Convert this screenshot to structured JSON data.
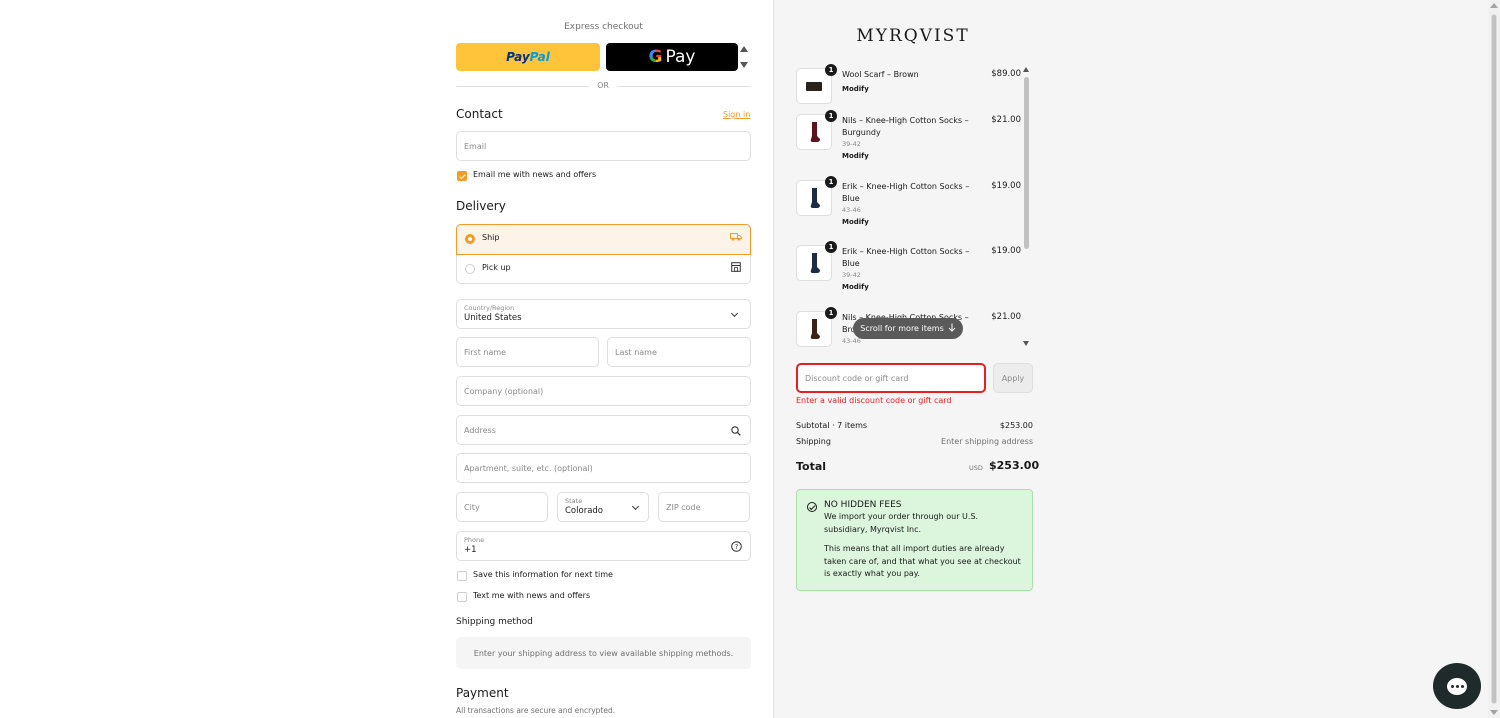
{
  "express": {
    "label": "Express checkout",
    "paypal_pay": "Pay",
    "paypal_pal": "Pal",
    "gpay_g": "G",
    "gpay_label": "Pay",
    "or_label": "OR"
  },
  "contact": {
    "heading": "Contact",
    "sign_in": "Sign in",
    "email_placeholder": "Email",
    "news_checkbox": "Email me with news and offers",
    "news_checked": true
  },
  "delivery": {
    "heading": "Delivery",
    "ship_label": "Ship",
    "pickup_label": "Pick up",
    "selected": "Ship",
    "country_label": "Country/Region",
    "country_value": "United States",
    "first_name_placeholder": "First name",
    "last_name_placeholder": "Last name",
    "company_placeholder": "Company (optional)",
    "address_placeholder": "Address",
    "apartment_placeholder": "Apartment, suite, etc. (optional)",
    "city_placeholder": "City",
    "state_label": "State",
    "state_value": "Colorado",
    "zip_placeholder": "ZIP code",
    "phone_label": "Phone",
    "phone_value": "+1",
    "save_info": "Save this information for next time",
    "text_me": "Text me with news and offers"
  },
  "shipping_method": {
    "heading": "Shipping method",
    "message": "Enter your shipping address to view available shipping methods."
  },
  "payment": {
    "heading": "Payment",
    "subtext": "All transactions are secure and encrypted."
  },
  "summary": {
    "brand": "MYRQVIST",
    "modify_label": "Modify",
    "items": [
      {
        "name": "Wool Scarf – Brown",
        "variant": "",
        "qty": "1",
        "price": "$89.00",
        "show_modify": true
      },
      {
        "name": "Nils – Knee-High Cotton Socks – Burgundy",
        "variant": "39-42",
        "qty": "1",
        "price": "$21.00",
        "show_modify": true
      },
      {
        "name": "Erik – Knee-High Cotton Socks – Blue",
        "variant": "43-46",
        "qty": "1",
        "price": "$19.00",
        "show_modify": true
      },
      {
        "name": "Erik – Knee-High Cotton Socks – Blue",
        "variant": "39-42",
        "qty": "1",
        "price": "$19.00",
        "show_modify": true
      },
      {
        "name": "Nils – Knee-High Cotton Socks – Brown",
        "variant": "43-46",
        "qty": "1",
        "price": "$21.00",
        "show_modify": false
      }
    ],
    "scroll_hint": "Scroll for more items",
    "discount_placeholder": "Discount code or gift card",
    "apply_label": "Apply",
    "discount_error": "Enter a valid discount code or gift card",
    "subtotal_label": "Subtotal · 7 items",
    "subtotal_value": "$253.00",
    "shipping_label": "Shipping",
    "shipping_value": "Enter shipping address",
    "total_label": "Total",
    "total_currency": "USD",
    "total_value": "$253.00"
  },
  "notice": {
    "title": "NO HIDDEN FEES",
    "line1": "We import your order through our U.S. subsidiary, Myrqvist Inc.",
    "line2": "This means that all import duties are already taken care of, and that what you see at checkout is exactly what you pay."
  },
  "colors": {
    "accent": "#f19a2d",
    "error": "#e22120",
    "notice_bg": "#dcf6dd"
  }
}
